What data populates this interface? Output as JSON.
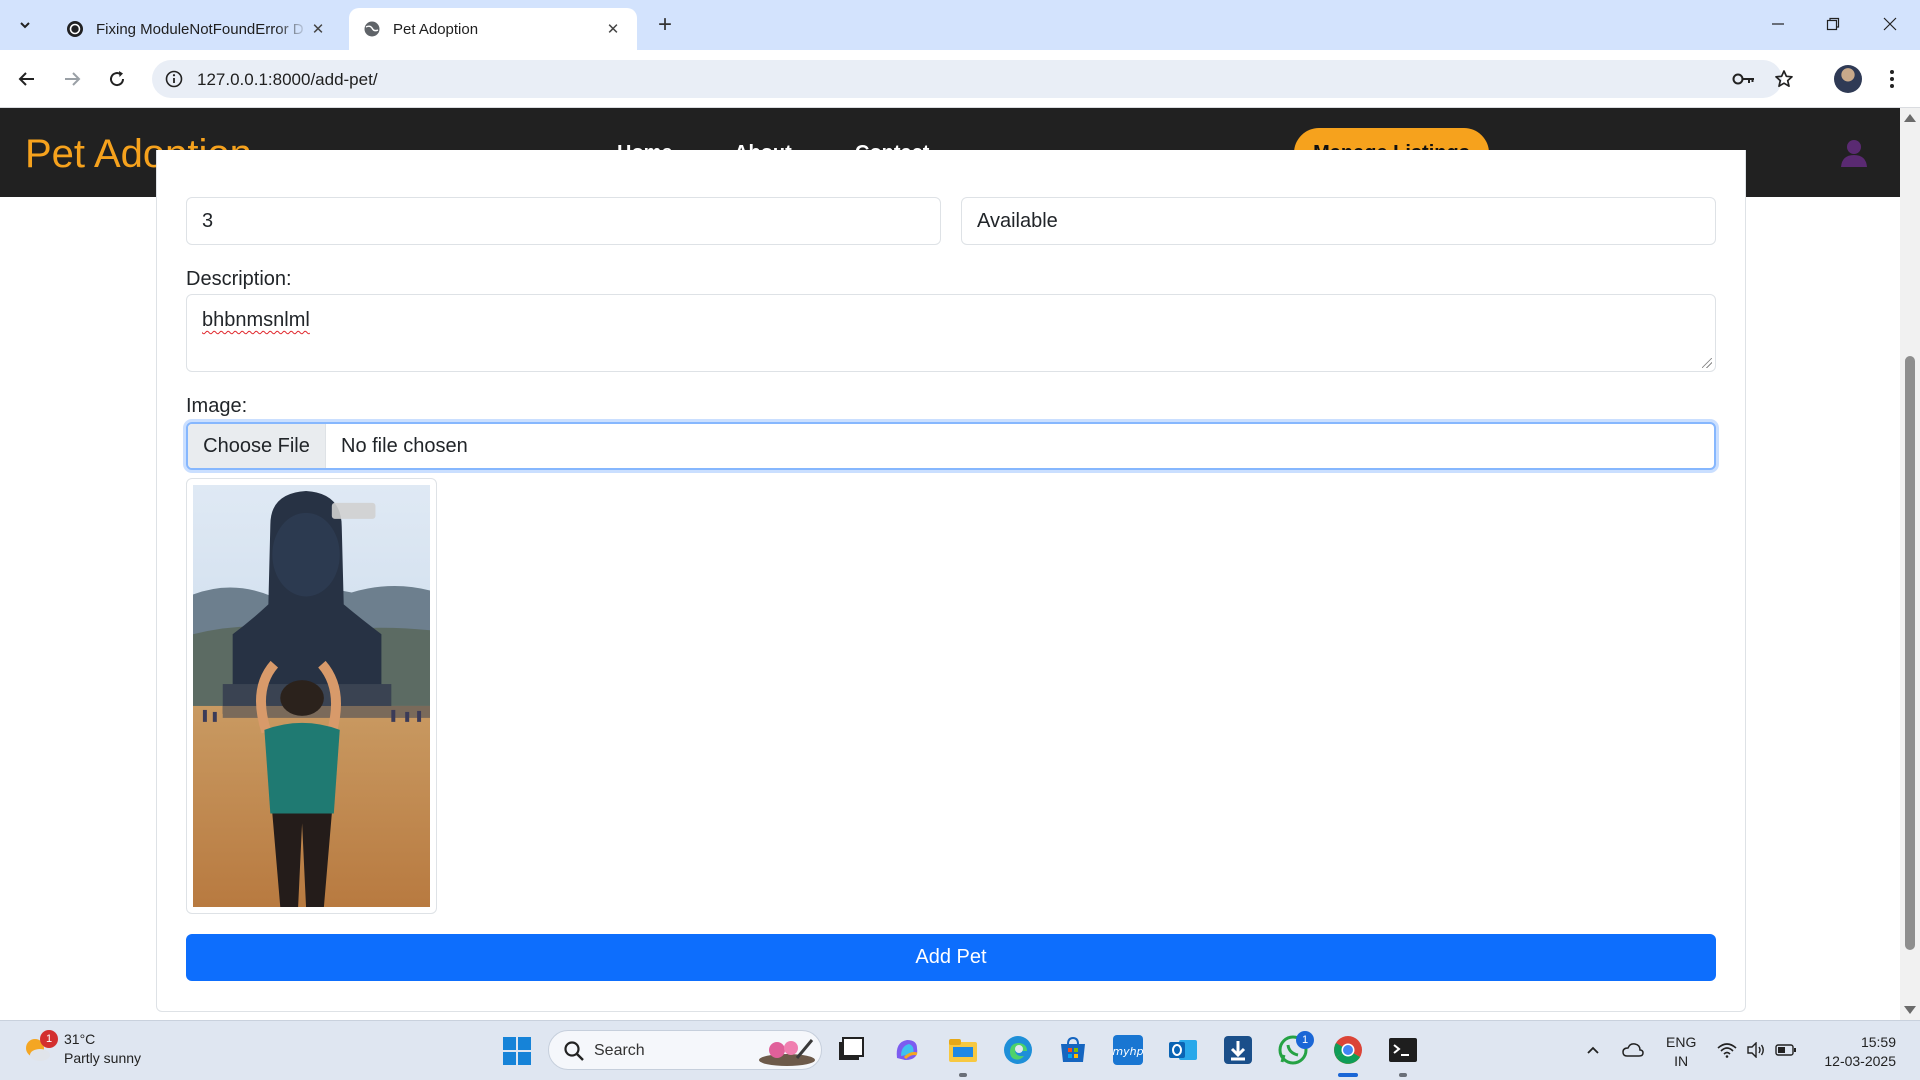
{
  "browser": {
    "tabs": [
      {
        "title": "Fixing ModuleNotFoundError D",
        "active": false
      },
      {
        "title": "Pet Adoption",
        "active": true
      }
    ],
    "url": "127.0.0.1:8000/add-pet/"
  },
  "navbar": {
    "brand": "Pet Adoption",
    "links": [
      "Home",
      "About",
      "Contact"
    ],
    "cta": "Manage Listings",
    "brand_color": "#f6a21d"
  },
  "form": {
    "field_left_value": "3",
    "field_right_value": "Available",
    "description_label": "Description:",
    "description_value": "bhbnmsnlml",
    "image_label": "Image:",
    "choose_file_label": "Choose File",
    "file_status": "No file chosen",
    "submit_label": "Add Pet",
    "submit_color": "#0d6efd"
  },
  "taskbar": {
    "weather_temp": "31°C",
    "weather_desc": "Partly sunny",
    "weather_badge": "1",
    "search_placeholder": "Search",
    "whatsapp_badge": "1",
    "lang_line1": "ENG",
    "lang_line2": "IN",
    "time": "15:59",
    "date": "12-03-2025"
  }
}
